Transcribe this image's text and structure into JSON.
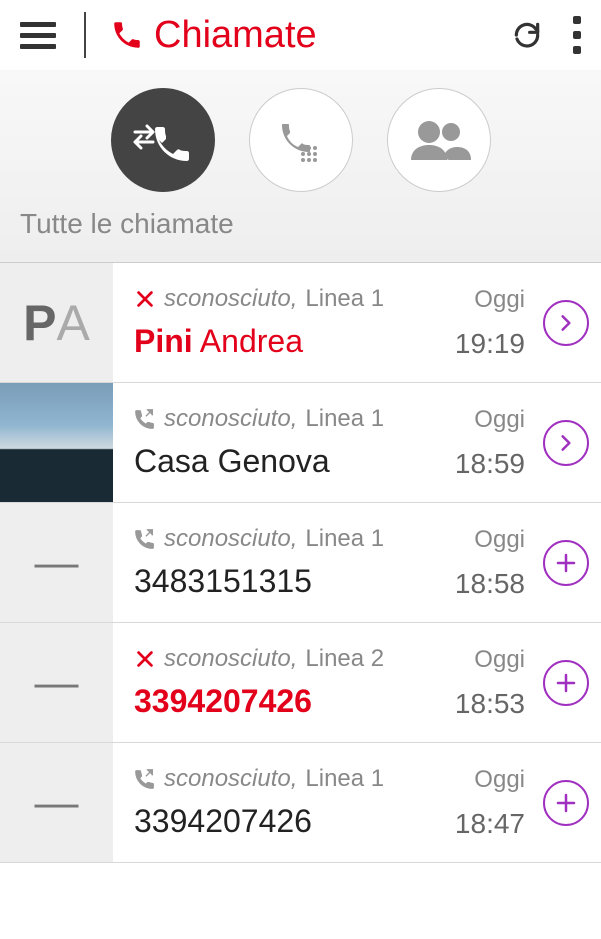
{
  "header": {
    "title": "Chiamate"
  },
  "tabs": {
    "label": "Tutte le chiamate"
  },
  "calls": [
    {
      "avatar_type": "initials",
      "avatar_text": "PA",
      "status": "missed",
      "meta": "sconosciuto,",
      "line": "Linea 1",
      "name_first": "Pini",
      "name_rest": "Andrea",
      "name_missed": true,
      "day": "Oggi",
      "time": "19:19",
      "action": "detail"
    },
    {
      "avatar_type": "photo",
      "status": "outgoing",
      "meta": "sconosciuto,",
      "line": "Linea 1",
      "name_first": "",
      "name_rest": "Casa Genova",
      "name_missed": false,
      "day": "Oggi",
      "time": "18:59",
      "action": "detail"
    },
    {
      "avatar_type": "dash",
      "status": "outgoing",
      "meta": "sconosciuto,",
      "line": "Linea 1",
      "name_first": "",
      "name_rest": "3483151315",
      "name_missed": false,
      "day": "Oggi",
      "time": "18:58",
      "action": "add"
    },
    {
      "avatar_type": "dash",
      "status": "missed",
      "meta": "sconosciuto,",
      "line": "Linea 2",
      "name_first": "",
      "name_rest": "3394207426",
      "name_missed": true,
      "day": "Oggi",
      "time": "18:53",
      "action": "add"
    },
    {
      "avatar_type": "dash",
      "status": "outgoing",
      "meta": "sconosciuto,",
      "line": "Linea 1",
      "name_first": "",
      "name_rest": "3394207426",
      "name_missed": false,
      "day": "Oggi",
      "time": "18:47",
      "action": "add"
    }
  ]
}
